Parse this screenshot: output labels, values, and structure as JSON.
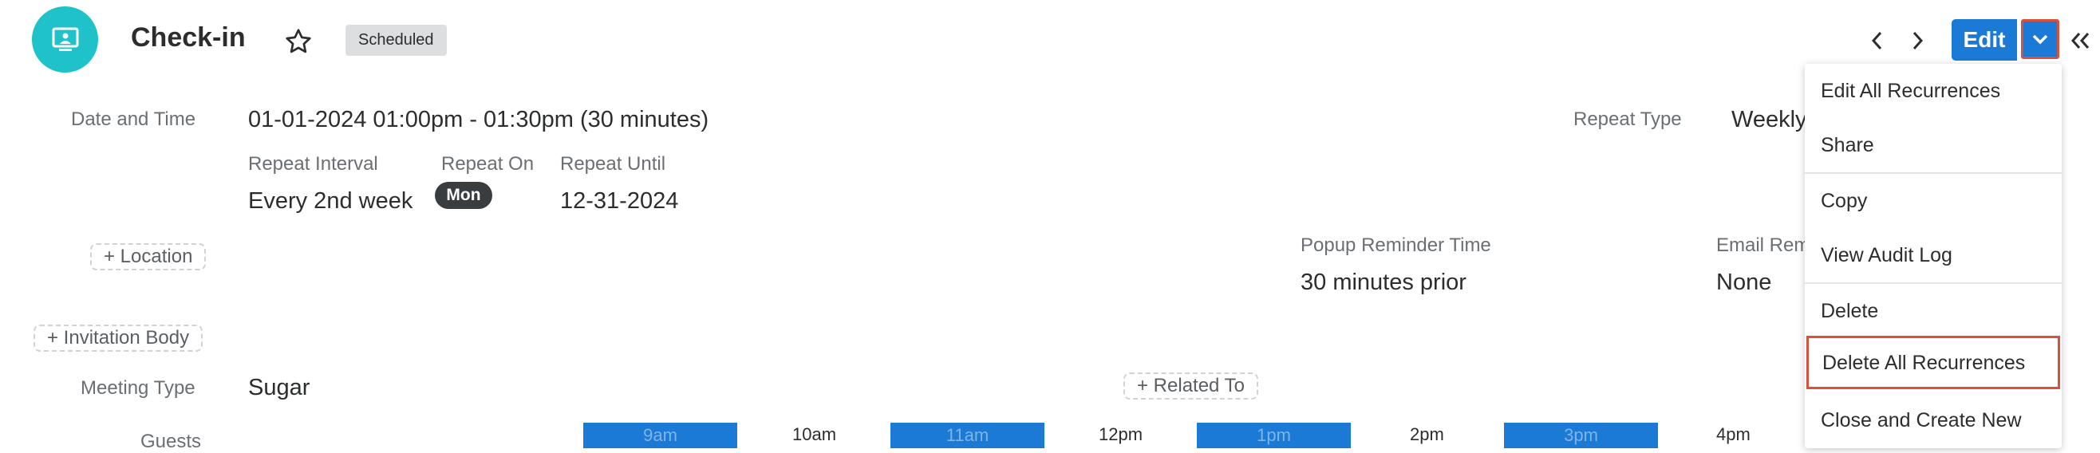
{
  "header": {
    "title": "Check-in",
    "status_badge": "Scheduled",
    "edit_label": "Edit"
  },
  "fields": {
    "date_time_label": "Date and Time",
    "date_time_value": "01-01-2024 01:00pm - 01:30pm (30 minutes)",
    "repeat_type_label": "Repeat Type",
    "repeat_type_value": "Weekly",
    "repeat_interval_label": "Repeat Interval",
    "repeat_interval_value": "Every 2nd week",
    "repeat_on_label": "Repeat On",
    "repeat_on_value": "Mon",
    "repeat_until_label": "Repeat Until",
    "repeat_until_value": "12-31-2024",
    "location_pill": "+ Location",
    "popup_reminder_label": "Popup Reminder Time",
    "popup_reminder_value": "30 minutes prior",
    "email_reminder_label": "Email Rem",
    "email_reminder_value": "None",
    "invitation_body_pill": "+ Invitation Body",
    "meeting_type_label": "Meeting Type",
    "meeting_type_value": "Sugar",
    "related_to_pill": "+ Related To",
    "guests_label": "Guests"
  },
  "timeline": {
    "slots": [
      "9am",
      "11am",
      "1pm",
      "3pm"
    ],
    "ticks": [
      "10am",
      "12pm",
      "2pm",
      "4pm"
    ]
  },
  "menu": {
    "items": [
      "Edit All Recurrences",
      "Share",
      "Copy",
      "View Audit Log",
      "Delete",
      "Delete All Recurrences",
      "Close and Create New"
    ]
  },
  "colors": {
    "accent": "#1a7ad6",
    "avatar": "#1fc2c9",
    "highlight": "#d9513c"
  },
  "icons": [
    "meeting-screen-icon",
    "star-icon",
    "chevron-left-icon",
    "chevron-right-icon",
    "chevron-down-icon",
    "double-chevron-left-icon"
  ]
}
